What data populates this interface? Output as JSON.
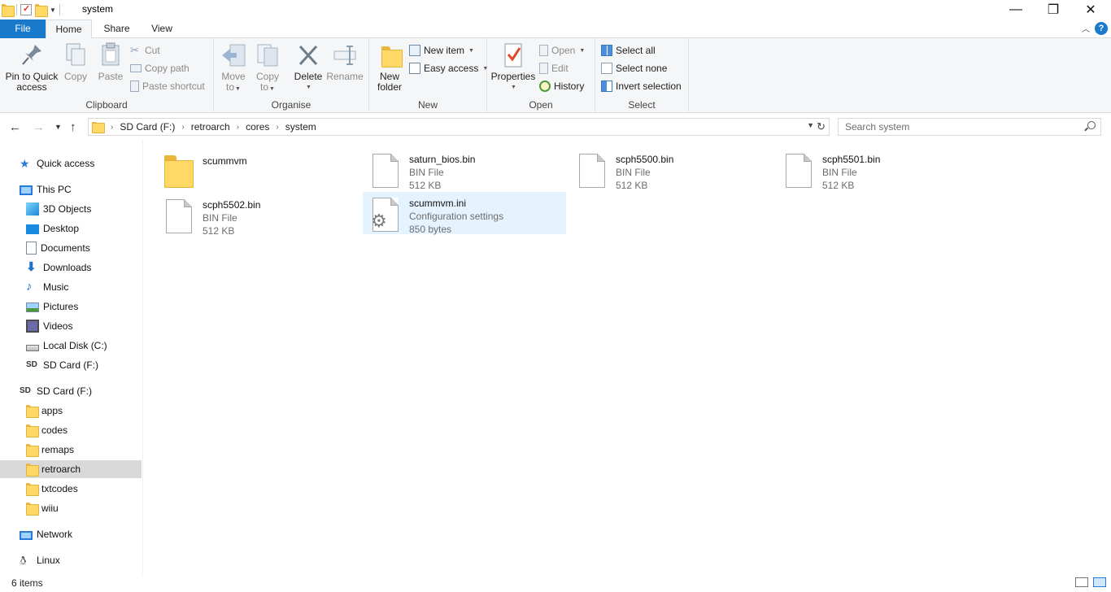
{
  "window": {
    "title": "system",
    "minimize_glyph": "—",
    "maximize_glyph": "❐",
    "close_glyph": "✕"
  },
  "ribbon_tabs": {
    "file": "File",
    "home": "Home",
    "share": "Share",
    "view": "View",
    "help": "?"
  },
  "ribbon": {
    "clipboard": {
      "label": "Clipboard",
      "pin_line1": "Pin to Quick",
      "pin_line2": "access",
      "copy": "Copy",
      "paste": "Paste",
      "cut": "Cut",
      "copy_path": "Copy path",
      "paste_shortcut": "Paste shortcut"
    },
    "organise": {
      "label": "Organise",
      "move_to_line1": "Move",
      "move_to_line2": "to",
      "copy_to_line1": "Copy",
      "copy_to_line2": "to",
      "delete": "Delete",
      "rename": "Rename"
    },
    "new": {
      "label": "New",
      "new_folder_line1": "New",
      "new_folder_line2": "folder",
      "new_item": "New item",
      "easy_access": "Easy access"
    },
    "open": {
      "label": "Open",
      "properties": "Properties",
      "open": "Open",
      "edit": "Edit",
      "history": "History"
    },
    "select": {
      "label": "Select",
      "select_all": "Select all",
      "select_none": "Select none",
      "invert_selection": "Invert selection"
    }
  },
  "address": {
    "breadcrumbs": [
      "SD Card (F:)",
      "retroarch",
      "cores",
      "system"
    ],
    "search_placeholder": "Search system"
  },
  "sidebar": {
    "quick_access": "Quick access",
    "this_pc": "This PC",
    "pc_items": [
      "3D Objects",
      "Desktop",
      "Documents",
      "Downloads",
      "Music",
      "Pictures",
      "Videos",
      "Local Disk (C:)",
      "SD Card (F:)"
    ],
    "sd_card": "SD Card (F:)",
    "sd_folders": [
      "apps",
      "codes",
      "remaps",
      "retroarch",
      "txtcodes",
      "wiiu"
    ],
    "selected_folder": "retroarch",
    "network": "Network",
    "linux": "Linux"
  },
  "files": [
    {
      "name": "scummvm",
      "type": "",
      "size": "",
      "kind": "folder"
    },
    {
      "name": "saturn_bios.bin",
      "type": "BIN File",
      "size": "512 KB",
      "kind": "file"
    },
    {
      "name": "scph5500.bin",
      "type": "BIN File",
      "size": "512 KB",
      "kind": "file"
    },
    {
      "name": "scph5501.bin",
      "type": "BIN File",
      "size": "512 KB",
      "kind": "file"
    },
    {
      "name": "scph5502.bin",
      "type": "BIN File",
      "size": "512 KB",
      "kind": "file"
    },
    {
      "name": "scummvm.ini",
      "type": "Configuration settings",
      "size": "850 bytes",
      "kind": "settings",
      "selected": true
    }
  ],
  "status": {
    "item_count": "6 items"
  },
  "colors": {
    "accent": "#1979ca",
    "selection": "#e5f3ff",
    "folder": "#ffd866"
  }
}
